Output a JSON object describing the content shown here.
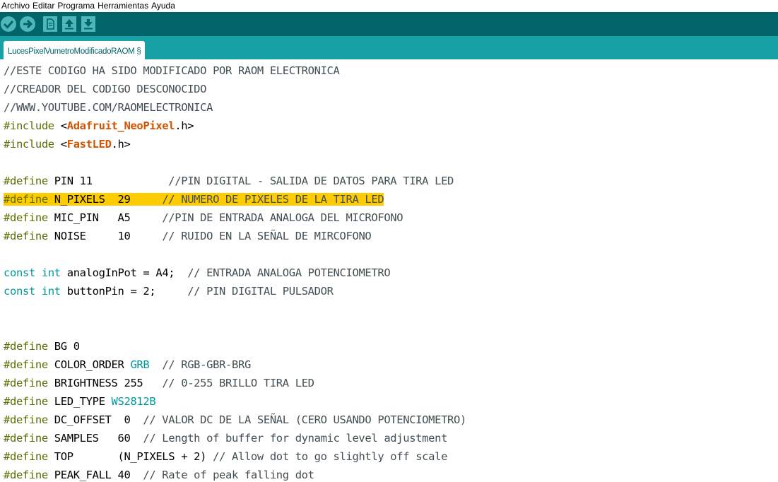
{
  "menu": [
    "Archivo",
    "Editar",
    "Programa",
    "Herramientas",
    "Ayuda"
  ],
  "toolbar": {
    "buttons": [
      "verify-icon",
      "upload-icon",
      "new-icon",
      "open-icon",
      "save-icon"
    ],
    "color": "#006468"
  },
  "tabs": [
    {
      "label": "LucesPixelVumetroModificadoRAOM §"
    }
  ],
  "colors": {
    "highlight": "#fecc00",
    "directive": "#5e6d03",
    "type": "#00979c",
    "library": "#d35400",
    "comment": "#434f54"
  },
  "code": {
    "lines": [
      {
        "segments": [
          {
            "t": "//ESTE CODIGO HA SIDO MODIFICADO POR RAOM ELECTRONICA",
            "c": "cm"
          }
        ]
      },
      {
        "segments": [
          {
            "t": "//CREADOR DEL CODIGO DESCONOCIDO",
            "c": "cm"
          }
        ]
      },
      {
        "segments": [
          {
            "t": "//WWW.YOUTUBE.COM/RAOMELECTRONICA",
            "c": "cm"
          }
        ]
      },
      {
        "segments": [
          {
            "t": "#include",
            "c": "kw-dir"
          },
          {
            "t": " <",
            "c": "plain"
          },
          {
            "t": "Adafruit_NeoPixel",
            "c": "lib"
          },
          {
            "t": ".h>",
            "c": "plain"
          }
        ]
      },
      {
        "segments": [
          {
            "t": "#include",
            "c": "kw-dir"
          },
          {
            "t": " <",
            "c": "plain"
          },
          {
            "t": "FastLED",
            "c": "lib"
          },
          {
            "t": ".h>",
            "c": "plain"
          }
        ]
      },
      {
        "segments": []
      },
      {
        "segments": [
          {
            "t": "#define",
            "c": "kw-dir"
          },
          {
            "t": " PIN 11            ",
            "c": "plain"
          },
          {
            "t": "//PIN DIGITAL - SALIDA DE DATOS PARA TIRA LED",
            "c": "cm"
          }
        ]
      },
      {
        "highlight": true,
        "segments": [
          {
            "t": "#define",
            "c": "kw-dir"
          },
          {
            "t": " N_PIXELS  29     ",
            "c": "plain"
          },
          {
            "t": "// NUMERO DE PIXELES DE LA TIRA LED",
            "c": "cm"
          }
        ]
      },
      {
        "segments": [
          {
            "t": "#define",
            "c": "kw-dir"
          },
          {
            "t": " MIC_PIN   A5     ",
            "c": "plain"
          },
          {
            "t": "//PIN DE ENTRADA ANALOGA DEL MICROFONO",
            "c": "cm"
          }
        ]
      },
      {
        "segments": [
          {
            "t": "#define",
            "c": "kw-dir"
          },
          {
            "t": " NOISE     10     ",
            "c": "plain"
          },
          {
            "t": "// RUIDO EN LA SEÑAL DE MIRCOFONO",
            "c": "cm"
          }
        ]
      },
      {
        "segments": []
      },
      {
        "segments": [
          {
            "t": "const",
            "c": "kw-type"
          },
          {
            "t": " ",
            "c": "plain"
          },
          {
            "t": "int",
            "c": "kw-type"
          },
          {
            "t": " analogInPot = A4;  ",
            "c": "plain"
          },
          {
            "t": "// ENTRADA ANALOGA POTENCIOMETRO",
            "c": "cm"
          }
        ]
      },
      {
        "segments": [
          {
            "t": "const",
            "c": "kw-type"
          },
          {
            "t": " ",
            "c": "plain"
          },
          {
            "t": "int",
            "c": "kw-type"
          },
          {
            "t": " buttonPin = 2;     ",
            "c": "plain"
          },
          {
            "t": "// PIN DIGITAL PULSADOR",
            "c": "cm"
          }
        ]
      },
      {
        "segments": []
      },
      {
        "segments": []
      },
      {
        "segments": [
          {
            "t": "#define",
            "c": "kw-dir"
          },
          {
            "t": " BG 0",
            "c": "plain"
          }
        ]
      },
      {
        "segments": [
          {
            "t": "#define",
            "c": "kw-dir"
          },
          {
            "t": " COLOR_ORDER ",
            "c": "plain"
          },
          {
            "t": "GRB",
            "c": "const"
          },
          {
            "t": "  ",
            "c": "plain"
          },
          {
            "t": "// RGB-GBR-BRG",
            "c": "cm"
          }
        ]
      },
      {
        "segments": [
          {
            "t": "#define",
            "c": "kw-dir"
          },
          {
            "t": " BRIGHTNESS 255   ",
            "c": "plain"
          },
          {
            "t": "// 0-255 BRILLO TIRA LED",
            "c": "cm"
          }
        ]
      },
      {
        "segments": [
          {
            "t": "#define",
            "c": "kw-dir"
          },
          {
            "t": " LED_TYPE ",
            "c": "plain"
          },
          {
            "t": "WS2812B",
            "c": "const"
          }
        ]
      },
      {
        "segments": [
          {
            "t": "#define",
            "c": "kw-dir"
          },
          {
            "t": " DC_OFFSET  0  ",
            "c": "plain"
          },
          {
            "t": "// VALOR DC DE LA SEÑAL (CERO USANDO POTENCIOMETRO)",
            "c": "cm"
          }
        ]
      },
      {
        "segments": [
          {
            "t": "#define",
            "c": "kw-dir"
          },
          {
            "t": " SAMPLES   60  ",
            "c": "plain"
          },
          {
            "t": "// Length of buffer for dynamic level adjustment",
            "c": "cm"
          }
        ]
      },
      {
        "segments": [
          {
            "t": "#define",
            "c": "kw-dir"
          },
          {
            "t": " TOP       (N_PIXELS + 2) ",
            "c": "plain"
          },
          {
            "t": "// Allow dot to go slightly off scale",
            "c": "cm"
          }
        ]
      },
      {
        "segments": [
          {
            "t": "#define",
            "c": "kw-dir"
          },
          {
            "t": " PEAK_FALL 40  ",
            "c": "plain"
          },
          {
            "t": "// Rate of peak falling dot",
            "c": "cm"
          }
        ]
      }
    ]
  }
}
